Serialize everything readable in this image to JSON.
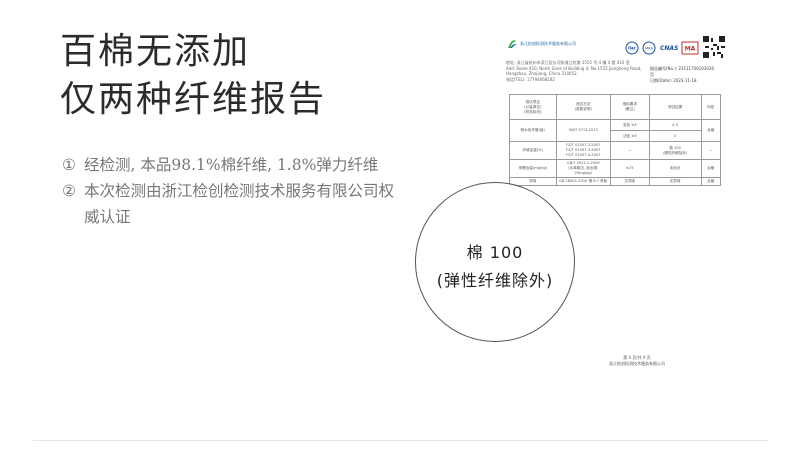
{
  "headline": {
    "line1": "百棉无添加",
    "line2": "仅两种纤维报告"
  },
  "points": [
    {
      "num": "①",
      "text": "经检测, 本品98.1%棉纤维, 1.8%弹力纤维"
    },
    {
      "num": "②",
      "text": "本次检测由浙江检创检测技术服务有限公司权威认证"
    }
  ],
  "report": {
    "org_name": "浙江检创检测技术服务有限公司",
    "address_lines": [
      "地址: 浙江省杭州市滨江区长河街道江虹路 1555 号 4 幢 4 楼 410 室",
      "Add: Room 410, North Zone of Building 4, No.1555 Jianghong Road,",
      "Hangzhou, Zhejiang, China 310052",
      "电话(TEL): 17794668182"
    ],
    "report_no": "报告编号(No.): 23111706103030",
    "page_label": "页",
    "date": "日期(Date): 2023-11-18",
    "table": {
      "headers": [
        "测试项目\n(计量单位)\n[样品标识]",
        "测试方法\n(参数说明)",
        "指标要求\n(备注)",
        "测试结果",
        "判定"
      ],
      "rows": [
        [
          "耐水色牢度(级)",
          "GB/T 5713-2013",
          "变色 ≥3",
          "4-5",
          "合格"
        ],
        [
          "",
          "",
          "沾色 ≥3",
          "3",
          ""
        ],
        [
          "纤维含量(%)",
          "FZ/T 01057.2-2007\nFZ/T 01057.3-2007\nFZ/T 01057.4-2007",
          "—",
          "棉 100\n(弹性纤维除外)",
          "—"
        ],
        [
          "甲醛含量(mg/kg)",
          "GB/T 2912.1-2009\n(水萃取法, 检出限:\n20mg/kg)",
          "≤75",
          "未检出",
          "合格"
        ],
        [
          "异味",
          "GB 18401-2010 第 6.7 条款",
          "无异味",
          "无异味",
          "合格"
        ]
      ]
    },
    "footer_page": "第 4 页/共 6 页",
    "footer_org": "浙江检创检测技术服务有限公司"
  },
  "lens": {
    "line1": "棉 100",
    "line2": "(弹性纤维除外)"
  }
}
